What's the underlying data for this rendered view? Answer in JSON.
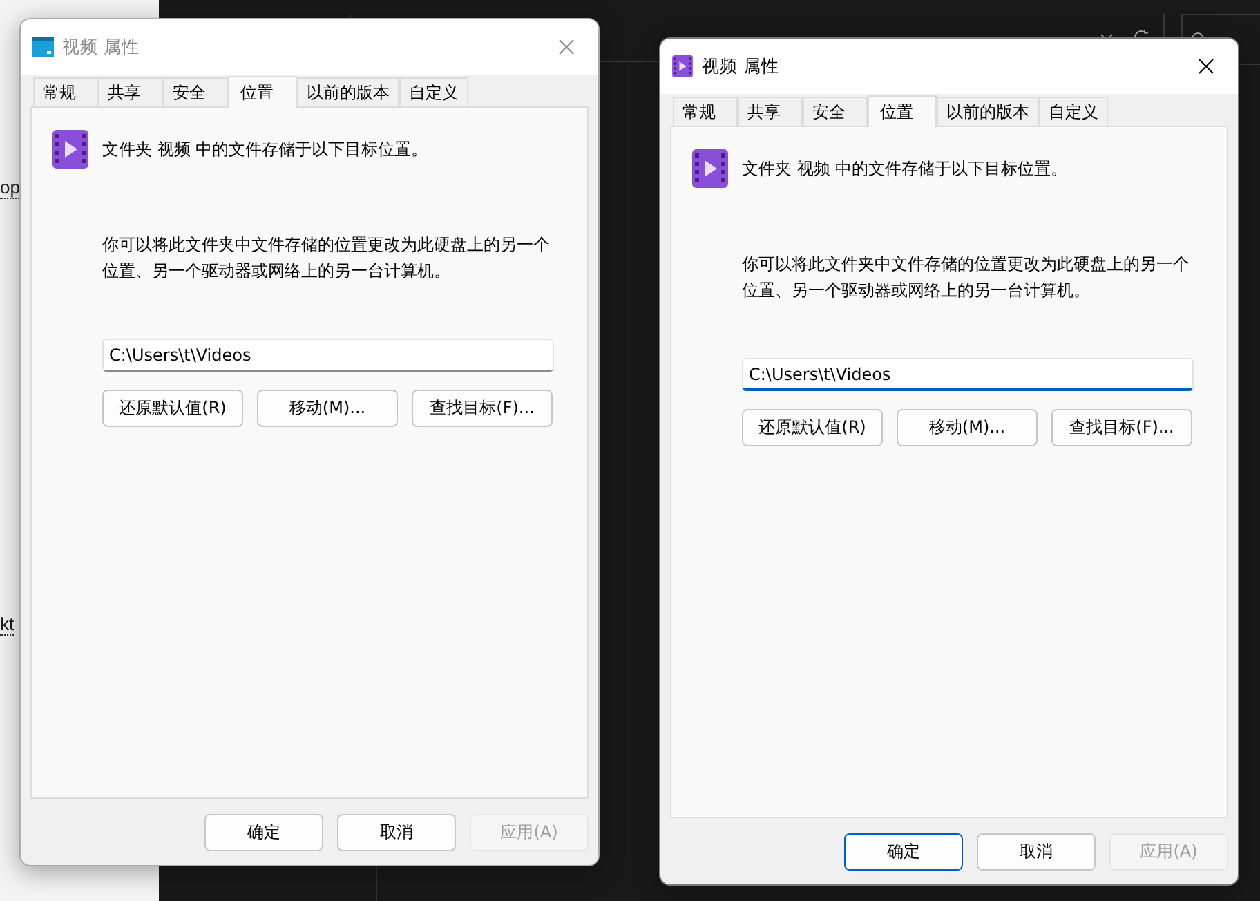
{
  "background": {
    "sidebar_texts": [
      "op",
      "kt"
    ]
  },
  "dialogs": [
    {
      "title": "视频 属性",
      "active": false,
      "icon": {
        "kind": "window"
      },
      "tabs": [
        {
          "label": "常规",
          "selected": false
        },
        {
          "label": "共享",
          "selected": false
        },
        {
          "label": "安全",
          "selected": false
        },
        {
          "label": "位置",
          "selected": true
        },
        {
          "label": "以前的版本",
          "selected": false
        },
        {
          "label": "自定义",
          "selected": false
        }
      ],
      "heading": "文件夹 视频 中的文件存储于以下目标位置。",
      "description": "你可以将此文件夹中文件存储的位置更改为此硬盘上的另一个位置、另一个驱动器或网络上的另一台计算机。",
      "path": {
        "value": "C:\\Users\\t\\Videos",
        "focused": false
      },
      "buttons": [
        "还原默认值(R)",
        "移动(M)...",
        "查找目标(F)..."
      ],
      "footer_buttons": [
        {
          "label": "确定",
          "default": false,
          "disabled": false
        },
        {
          "label": "取消",
          "default": false,
          "disabled": false
        },
        {
          "label": "应用(A)",
          "default": false,
          "disabled": true
        }
      ]
    },
    {
      "title": "视频 属性",
      "active": true,
      "icon": {
        "kind": "video"
      },
      "tabs": [
        {
          "label": "常规",
          "selected": false
        },
        {
          "label": "共享",
          "selected": false
        },
        {
          "label": "安全",
          "selected": false
        },
        {
          "label": "位置",
          "selected": true
        },
        {
          "label": "以前的版本",
          "selected": false
        },
        {
          "label": "自定义",
          "selected": false
        }
      ],
      "heading": "文件夹 视频 中的文件存储于以下目标位置。",
      "description": "你可以将此文件夹中文件存储的位置更改为此硬盘上的另一个位置、另一个驱动器或网络上的另一台计算机。",
      "path": {
        "value": "C:\\Users\\t\\Videos",
        "focused": true
      },
      "buttons": [
        "还原默认值(R)",
        "移动(M)...",
        "查找目标(F)..."
      ],
      "footer_buttons": [
        {
          "label": "确定",
          "default": true,
          "disabled": false
        },
        {
          "label": "取消",
          "default": false,
          "disabled": false
        },
        {
          "label": "应用(A)",
          "default": false,
          "disabled": true
        }
      ]
    }
  ]
}
